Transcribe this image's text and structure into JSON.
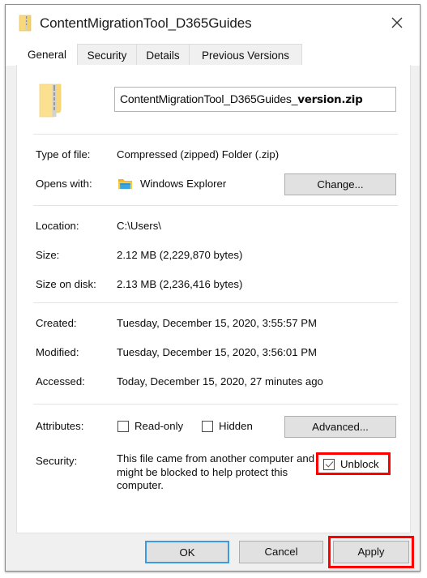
{
  "window": {
    "title": "ContentMigrationTool_D365Guides",
    "title_icon": "zip-folder-icon",
    "close_icon": "close-icon"
  },
  "tabs": [
    {
      "label": "General",
      "active": true
    },
    {
      "label": "Security",
      "active": false
    },
    {
      "label": "Details",
      "active": false
    },
    {
      "label": "Previous Versions",
      "active": false
    }
  ],
  "file_header": {
    "icon": "zip-folder-icon",
    "filename_base": "ContentMigrationTool_D365Guides_",
    "filename_emphasis": "version.zip"
  },
  "properties": {
    "type_of_file": {
      "label": "Type of file:",
      "value": "Compressed (zipped) Folder (.zip)"
    },
    "opens_with": {
      "label": "Opens with:",
      "app_icon": "windows-explorer-folder-icon",
      "app_name": "Windows Explorer",
      "button": "Change..."
    },
    "location": {
      "label": "Location:",
      "value": "C:\\Users\\"
    },
    "size": {
      "label": "Size:",
      "value": "2.12 MB (2,229,870 bytes)"
    },
    "size_on_disk": {
      "label": "Size on disk:",
      "value": "2.13 MB (2,236,416 bytes)"
    },
    "created": {
      "label": "Created:",
      "value": "Tuesday, December 15, 2020, 3:55:57 PM"
    },
    "modified": {
      "label": "Modified:",
      "value": "Tuesday, December 15, 2020, 3:56:01 PM"
    },
    "accessed": {
      "label": "Accessed:",
      "value": "Today, December 15, 2020, 27 minutes ago"
    }
  },
  "attributes": {
    "label": "Attributes:",
    "read_only": {
      "label": "Read-only",
      "checked": false
    },
    "hidden": {
      "label": "Hidden",
      "checked": false
    },
    "advanced_button": "Advanced..."
  },
  "security": {
    "label": "Security:",
    "description": "This file came from another computer and might be blocked to help protect this computer.",
    "unblock": {
      "label": "Unblock",
      "checked": true
    }
  },
  "footer": {
    "ok": "OK",
    "cancel": "Cancel",
    "apply": "Apply"
  },
  "annotations": {
    "highlight_color": "#ff0000",
    "highlighted": [
      "unblock-checkbox",
      "apply-button"
    ]
  }
}
